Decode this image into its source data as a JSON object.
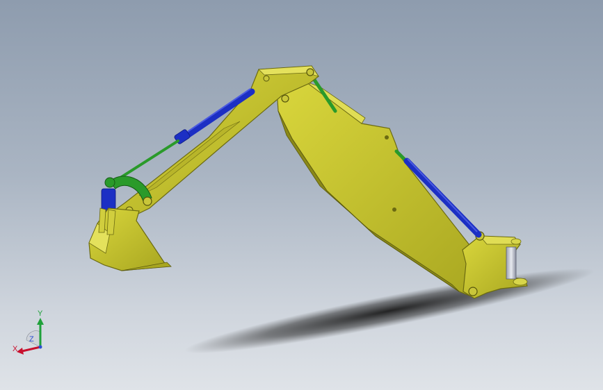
{
  "triad": {
    "x_label": "X",
    "y_label": "Y",
    "z_label": "Z",
    "x_color": "#c8102e",
    "y_color": "#1fa13a",
    "z_color": "#2a4fd0"
  },
  "model": {
    "body_color": "#c7c42e",
    "body_edge_color": "#6b6a12",
    "cylinder_color": "#1c2fc4",
    "rod_color": "#2a9a2a",
    "shadow_color": "#1e1e1e"
  }
}
